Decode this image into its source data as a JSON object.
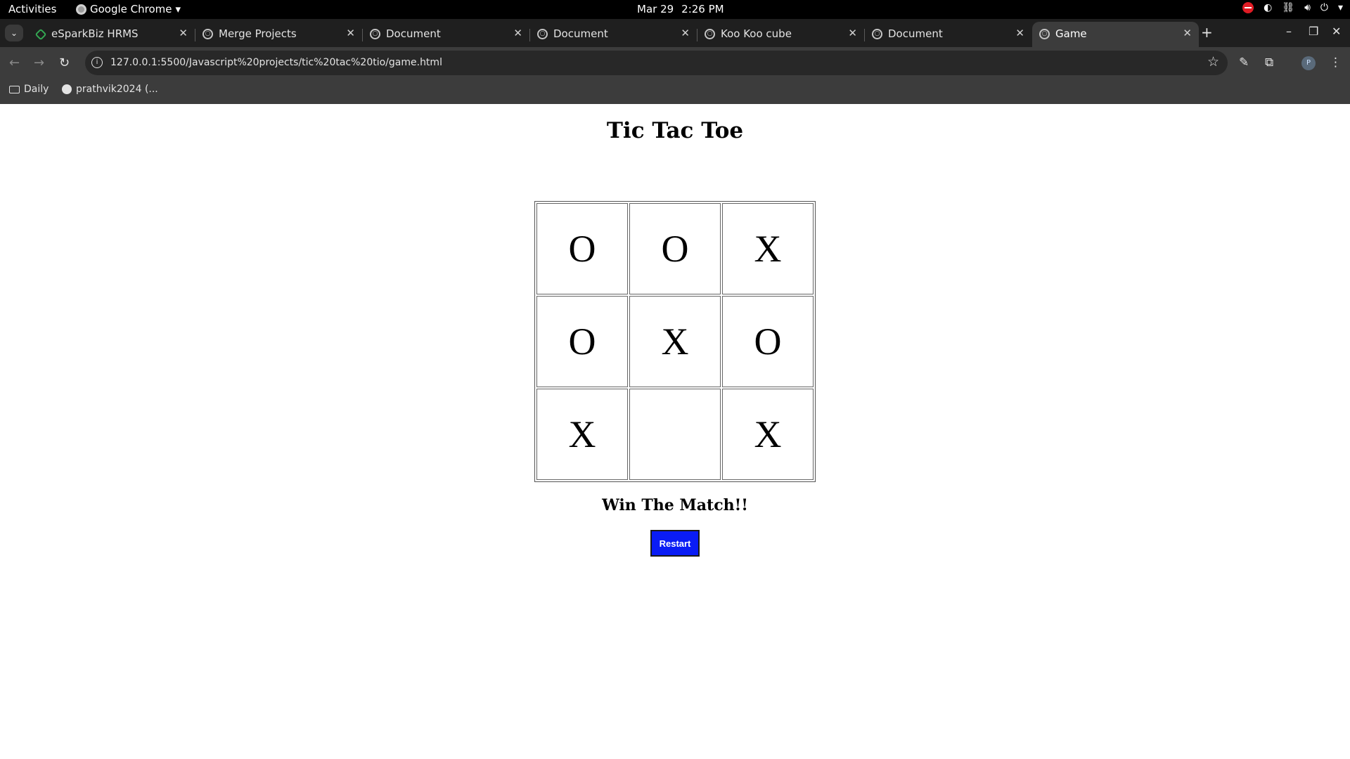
{
  "system": {
    "activities": "Activities",
    "app_menu": "Google Chrome",
    "date": "Mar 29",
    "time": "2:26 PM"
  },
  "browser": {
    "tabs": [
      {
        "title": "eSparkBiz HRMS",
        "icon": "esparkbiz-icon"
      },
      {
        "title": "Merge Projects",
        "icon": "globe-icon"
      },
      {
        "title": "Document",
        "icon": "globe-icon"
      },
      {
        "title": "Document",
        "icon": "globe-icon"
      },
      {
        "title": "Koo Koo cube",
        "icon": "globe-icon"
      },
      {
        "title": "Document",
        "icon": "globe-icon"
      },
      {
        "title": "Game",
        "icon": "globe-icon",
        "active": true
      }
    ],
    "url": "127.0.0.1:5500/Javascript%20projects/tic%20tac%20tio/game.html",
    "bookmarks": [
      {
        "label": "Daily",
        "icon": "folder-icon"
      },
      {
        "label": "prathvik2024 (...",
        "icon": "github-icon"
      }
    ],
    "profile_initial": "P"
  },
  "game": {
    "title": "Tic Tac Toe",
    "board": [
      [
        "O",
        "O",
        "X"
      ],
      [
        "O",
        "X",
        "O"
      ],
      [
        "X",
        "",
        "X"
      ]
    ],
    "message": "Win The Match!!",
    "restart_label": "Restart",
    "restart_color": "#0a1cf5"
  }
}
